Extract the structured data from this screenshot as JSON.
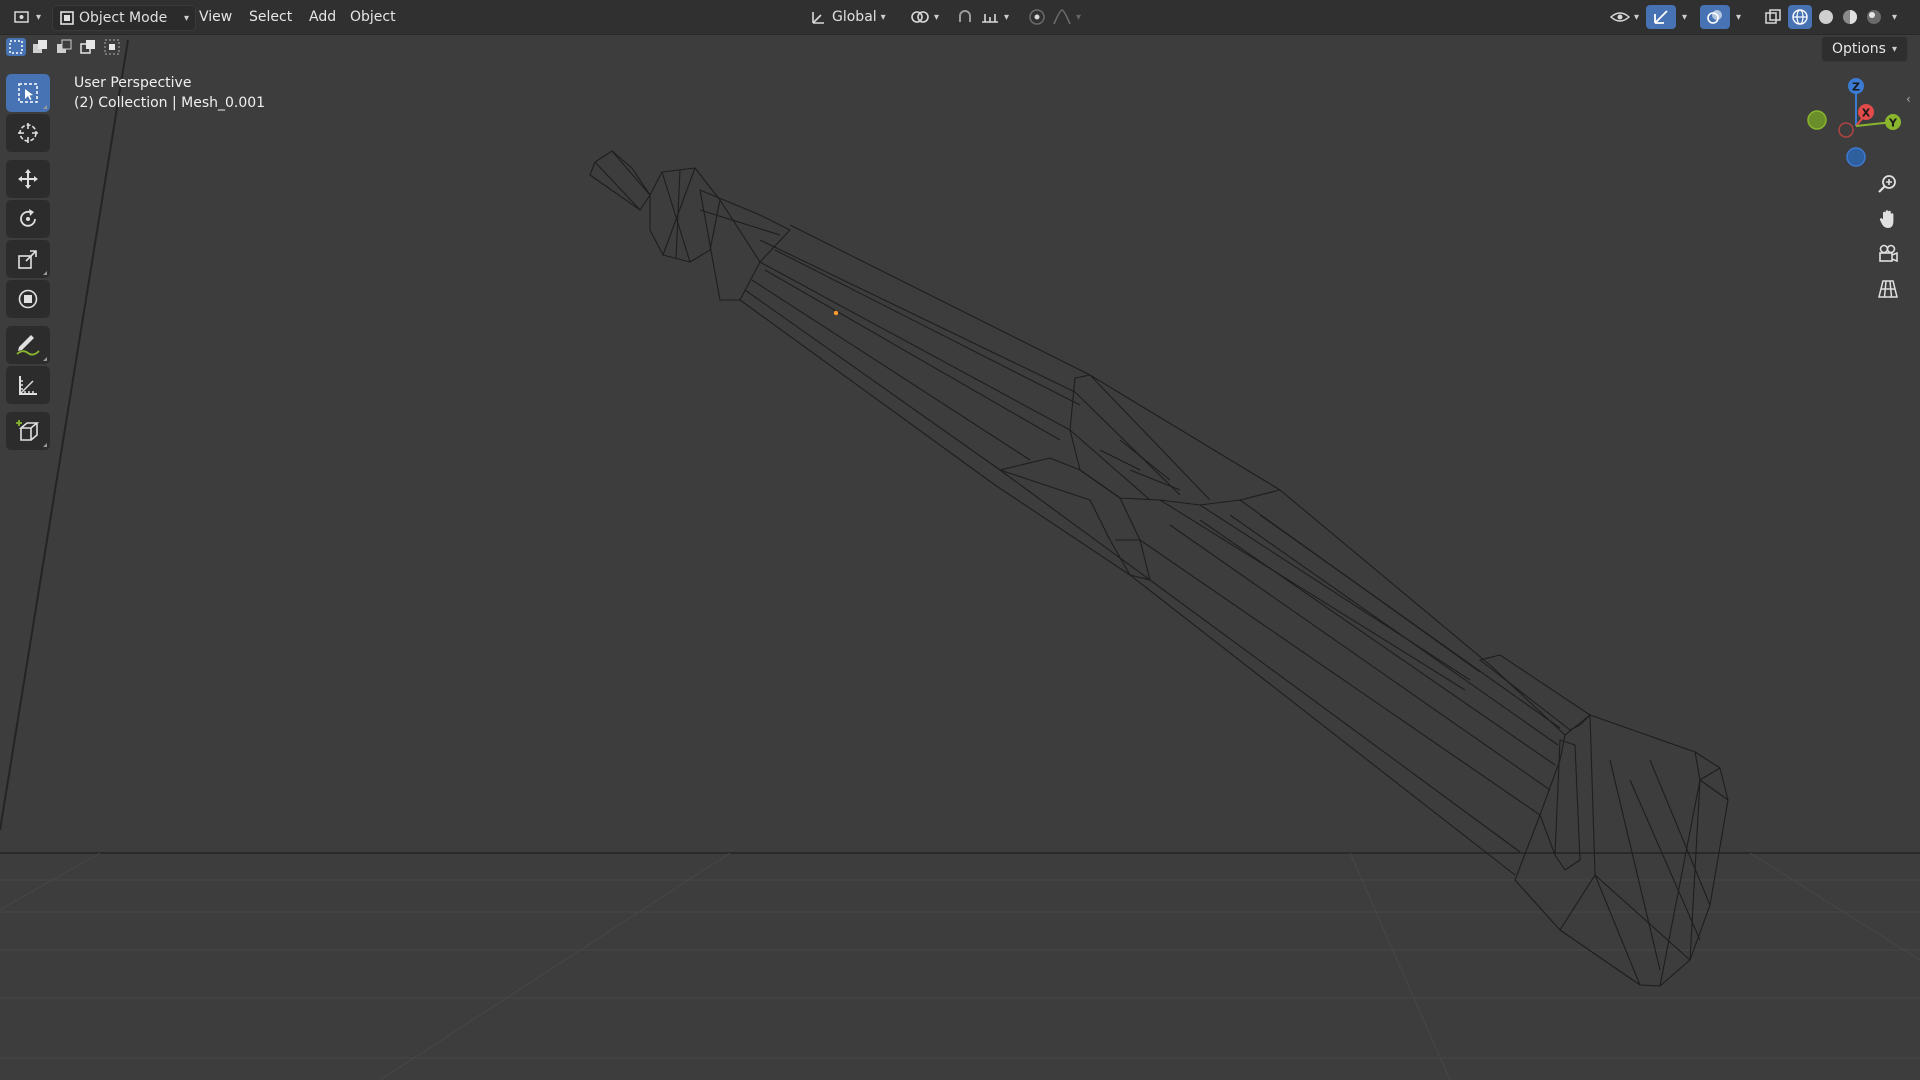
{
  "header": {
    "mode_label": "Object Mode",
    "menu": {
      "view": "View",
      "select": "Select",
      "add": "Add",
      "object": "Object"
    },
    "transform_orientation": "Global"
  },
  "toolbar_row": {
    "options_label": "Options"
  },
  "viewport": {
    "view_name": "User Perspective",
    "context": "(2) Collection | Mesh_0.001"
  },
  "gizmo": {
    "z": "Z",
    "x": "X",
    "y": "Y"
  },
  "icons": [
    "editor-type-icon",
    "object-mode-icon",
    "transform-orientation-icon",
    "pivot-icon",
    "snap-icon",
    "snap-target-icon",
    "proportional-edit-icon",
    "falloff-icon",
    "visibility-icon",
    "gizmo-icon",
    "overlay-icon",
    "xray-icon",
    "wireframe-shading-icon",
    "solid-shading-icon",
    "material-shading-icon",
    "rendered-shading-icon",
    "select-box-icon",
    "cursor-icon",
    "move-icon",
    "rotate-icon",
    "scale-icon",
    "transform-icon",
    "annotate-icon",
    "measure-icon",
    "add-cube-icon",
    "zoom-icon",
    "pan-hand-icon",
    "camera-icon",
    "grid-view-icon"
  ],
  "colors": {
    "accent": "#4772b3",
    "header_bg": "#303030",
    "viewport_bg": "#3d3d3d",
    "axis_x": "#e34a4a",
    "axis_y": "#8ab62e",
    "axis_z": "#3b7bd4",
    "origin": "#ff9a2e"
  }
}
